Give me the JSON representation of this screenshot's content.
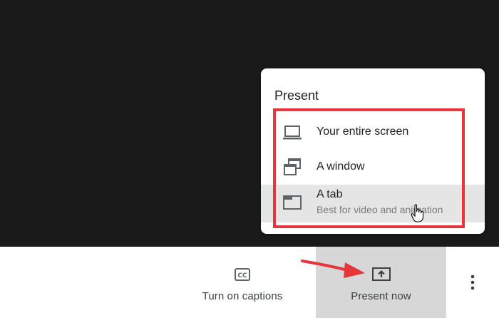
{
  "menu": {
    "title": "Present",
    "items": [
      {
        "label": "Your entire screen",
        "icon": "laptop-icon"
      },
      {
        "label": "A window",
        "icon": "window-stack-icon"
      },
      {
        "label": "A tab",
        "sublabel": "Best for video and animation",
        "icon": "tab-icon"
      }
    ]
  },
  "bottom_bar": {
    "captions": {
      "label": "Turn on captions",
      "icon": "cc-icon"
    },
    "present": {
      "label": "Present now",
      "icon": "present-upload-icon"
    },
    "more": {
      "icon": "more-vert-icon"
    }
  },
  "colors": {
    "background_dark": "#1a1a1a",
    "highlight_red": "#e8343b",
    "active_button_bg": "#d7d7d7",
    "hover_item_bg": "#e5e5e5"
  }
}
